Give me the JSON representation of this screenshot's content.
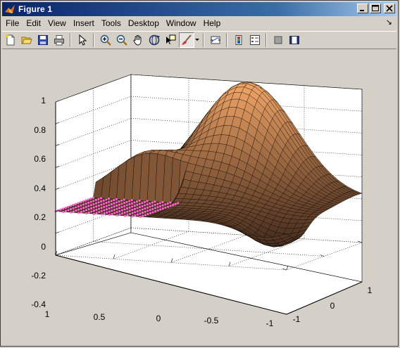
{
  "window": {
    "title": "Figure 1",
    "controls": {
      "minimize": "minimize",
      "maximize": "maximize",
      "close": "close"
    }
  },
  "menu": {
    "items": [
      "File",
      "Edit",
      "View",
      "Insert",
      "Tools",
      "Desktop",
      "Window",
      "Help"
    ],
    "dock_glyph": "↘"
  },
  "toolbar": {
    "buttons": [
      {
        "icon": "new-figure-icon"
      },
      {
        "icon": "open-file-icon"
      },
      {
        "icon": "save-icon"
      },
      {
        "icon": "print-icon"
      },
      {
        "icon": "edit-plot-arrow-icon"
      },
      {
        "icon": "zoom-in-icon"
      },
      {
        "icon": "zoom-out-icon"
      },
      {
        "icon": "pan-hand-icon"
      },
      {
        "icon": "rotate-3d-icon"
      },
      {
        "icon": "data-cursor-icon"
      },
      {
        "icon": "brush-icon"
      },
      {
        "icon": "link-plot-icon"
      },
      {
        "icon": "colorbar-icon"
      },
      {
        "icon": "legend-icon"
      },
      {
        "icon": "hide-plot-tools-icon"
      },
      {
        "icon": "show-plot-tools-icon"
      }
    ]
  },
  "axes": {
    "z_ticks": [
      "1",
      "0.8",
      "0.6",
      "0.4",
      "0.2",
      "0",
      "-0.2",
      "-0.4"
    ],
    "x_ticks": [
      "1",
      "0.5",
      "0",
      "-0.5",
      "-1"
    ],
    "y_ticks": [
      "1",
      "0",
      "-1"
    ],
    "colors": {
      "surface_light": "#f0a466",
      "surface_dark": "#3a2418",
      "brushed": "#ff66cc",
      "background": "#ffffff"
    }
  }
}
